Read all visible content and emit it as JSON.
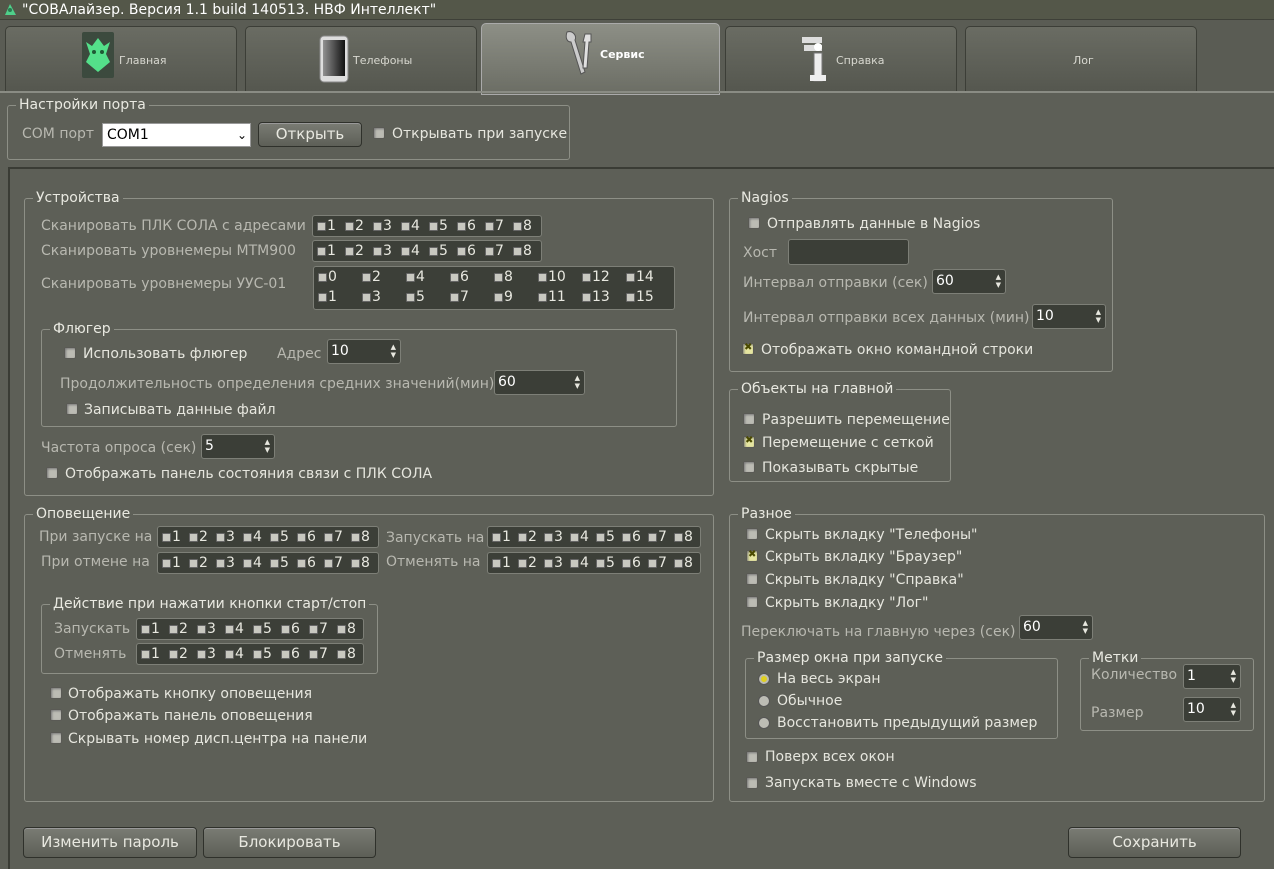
{
  "window": {
    "title": "\"СОВАлайзер. Версия 1.1 build 140513. НВФ Интеллект\""
  },
  "tabs": [
    {
      "label": "Главная",
      "icon": "owl-icon"
    },
    {
      "label": "Телефоны",
      "icon": "phone-icon"
    },
    {
      "label": "Сервис",
      "icon": "tools-icon"
    },
    {
      "label": "Справка",
      "icon": "info-icon"
    },
    {
      "label": "Лог",
      "icon": ""
    }
  ],
  "port": {
    "title": "Настройки порта",
    "com_label": "COM порт",
    "com_value": "COM1",
    "open_button": "Открыть",
    "open_on_start": "Открывать при запуске"
  },
  "devices": {
    "title": "Устройства",
    "scan_plc": "Сканировать ПЛК СОЛА с адресами",
    "scan_mtm": "Сканировать уровнемеры МТМ900",
    "scan_uus": "Сканировать уровнемеры УУС-01",
    "nums8": [
      "1",
      "2",
      "3",
      "4",
      "5",
      "6",
      "7",
      "8"
    ],
    "uus_row1": [
      "0",
      "2",
      "4",
      "6",
      "8",
      "10",
      "12",
      "14"
    ],
    "uus_row2": [
      "1",
      "3",
      "5",
      "7",
      "9",
      "11",
      "13",
      "15"
    ],
    "vane": {
      "title": "Флюгер",
      "use": "Использовать флюгер",
      "address_label": "Адрес",
      "address_value": "10",
      "duration_label": "Продолжительность определения средних значений(мин)",
      "duration_value": "60",
      "write_file": "Записывать данные файл"
    },
    "poll_label": "Частота опроса (сек)",
    "poll_value": "5",
    "show_panel": "Отображать панель состояния связи с ПЛК СОЛА"
  },
  "alert": {
    "title": "Оповещение",
    "on_start": "При запуске на",
    "run_on": "Запускать на",
    "on_cancel": "При отмене на",
    "cancel_on": "Отменять на",
    "action": {
      "title": "Действие при нажатии кнопки старт/стоп",
      "run": "Запускать",
      "cancel": "Отменять"
    },
    "show_button": "Отображать кнопку оповещения",
    "show_panel": "Отображать панель оповещения",
    "hide_number": "Скрывать номер дисп.центра на панели"
  },
  "nagios": {
    "title": "Nagios",
    "send": "Отправлять данные в Nagios",
    "host_label": "Хост",
    "interval_label": "Интервал отправки (сек)",
    "interval_value": "60",
    "all_label": "Интервал отправки всех данных (мин)",
    "all_value": "10",
    "show_cmd": "Отображать окно командной строки"
  },
  "objects": {
    "title": "Объекты на главной",
    "allow_move": "Разрешить перемещение",
    "grid_move": "Перемещение с сеткой",
    "show_hidden": "Показывать скрытые"
  },
  "misc": {
    "title": "Разное",
    "hide_phones": "Скрыть вкладку \"Телефоны\"",
    "hide_browser": "Скрыть вкладку \"Браузер\"",
    "hide_help": "Скрыть вкладку \"Справка\"",
    "hide_log": "Скрыть вкладку \"Лог\"",
    "switch_label": "Переключать на главную через (сек)",
    "switch_value": "60",
    "size": {
      "title": "Размер окна при запуске",
      "full": "На весь экран",
      "normal": "Обычное",
      "restore": "Восстановить предыдущий размер"
    },
    "marks": {
      "title": "Метки",
      "count_label": "Количество",
      "count_value": "1",
      "size_label": "Размер",
      "size_value": "10"
    },
    "topmost": "Поверх всех окон",
    "autostart": "Запускать вместе с Windows"
  },
  "buttons": {
    "change_password": "Изменить пароль",
    "lock": "Блокировать",
    "save": "Сохранить"
  }
}
